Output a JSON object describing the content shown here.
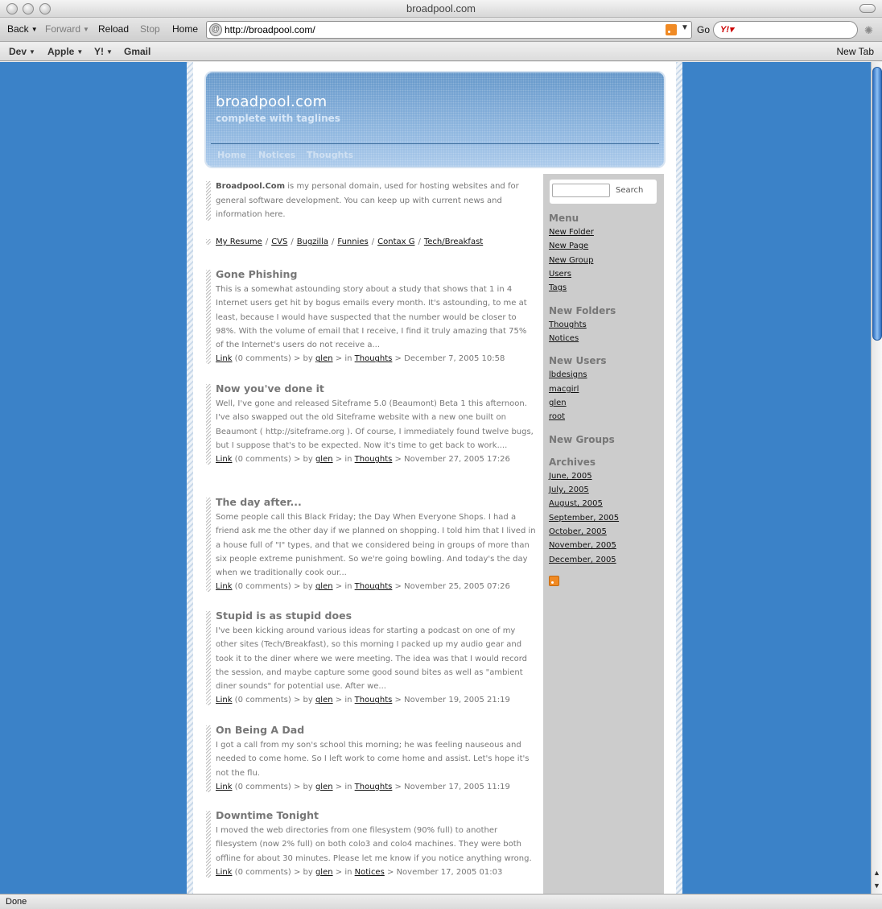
{
  "window": {
    "title": "broadpool.com"
  },
  "toolbar": {
    "back": "Back",
    "forward": "Forward",
    "reload": "Reload",
    "stop": "Stop",
    "home": "Home",
    "url": "http://broadpool.com/",
    "go": "Go"
  },
  "bookmarks": {
    "dev": "Dev",
    "apple": "Apple",
    "yahoo": "Y!",
    "gmail": "Gmail",
    "new_tab": "New Tab"
  },
  "header": {
    "title": "broadpool.com",
    "tagline": "complete with taglines",
    "nav": [
      "Home",
      "Notices",
      "Thoughts"
    ]
  },
  "intro": {
    "bold": "Broadpool.Com",
    "text": " is my personal domain, used for hosting websites and for general software development. You can keep up with current news and information here."
  },
  "links": [
    "My Resume",
    "CVS",
    "Bugzilla",
    "Funnies",
    "Contax G",
    "Tech/Breakfast"
  ],
  "meta_labels": {
    "link": "Link",
    "comments": "(0 comments)",
    "by": "> by",
    "in": "> in",
    "gt": ">"
  },
  "posts": [
    {
      "title": "Gone Phishing",
      "body": "This is a somewhat astounding story about a study that shows that 1 in 4 Internet users get hit by bogus emails every month. It's astounding, to me at least, because I would have suspected that the number would be closer to 98%. With the volume of email that I receive, I find it truly amazing that 75% of the Internet's users do not receive a...",
      "author": "glen",
      "category": "Thoughts",
      "date": "December 7, 2005 10:58"
    },
    {
      "title": "Now you've done it",
      "body": "Well, I've gone and released Siteframe 5.0 (Beaumont) Beta 1 this afternoon. I've also swapped out the old Siteframe website with a new one built on Beaumont ( http://siteframe.org ). Of course, I immediately found twelve bugs, but I suppose that's to be expected. Now it's time to get back to work....",
      "author": "glen",
      "category": "Thoughts",
      "date": "November 27, 2005 17:26"
    },
    {
      "title": "The day after...",
      "body": "Some people call this Black Friday; the Day When Everyone Shops. I had a friend ask me the other day if we planned on shopping. I told him that I lived in a house full of \"I\" types, and that we considered being in groups of more than six people extreme punishment. So we're going bowling. And today's the day when we traditionally cook our...",
      "author": "glen",
      "category": "Thoughts",
      "date": "November 25, 2005 07:26"
    },
    {
      "title": "Stupid is as stupid does",
      "body": "I've been kicking around various ideas for starting a podcast on one of my other sites (Tech/Breakfast), so this morning I packed up my audio gear and took it to the diner where we were meeting. The idea was that I would record the session, and maybe capture some good sound bites as well as \"ambient diner sounds\" for potential use. After we...",
      "author": "glen",
      "category": "Thoughts",
      "date": "November 19, 2005 21:19"
    },
    {
      "title": "On Being A Dad",
      "body": "I got a call from my son's school this morning; he was feeling nauseous and needed to come home. So I left work to come home and assist. Let's hope it's not the flu.",
      "author": "glen",
      "category": "Thoughts",
      "date": "November 17, 2005 11:19"
    },
    {
      "title": "Downtime Tonight",
      "body": "I moved the web directories from one filesystem (90% full) to another filesystem (now 2% full) on both colo3 and colo4 machines. They were both offline for about 30 minutes. Please let me know if you notice anything wrong.",
      "author": "glen",
      "category": "Notices",
      "date": "November 17, 2005 01:03"
    }
  ],
  "sidebar": {
    "search_button": "Search",
    "menu_title": "Menu",
    "menu": [
      "New Folder",
      "New Page",
      "New Group",
      "Users",
      "Tags"
    ],
    "folders_title": "New Folders",
    "folders": [
      "Thoughts",
      "Notices"
    ],
    "users_title": "New Users",
    "users": [
      "lbdesigns",
      "macgirl",
      "glen",
      "root"
    ],
    "groups_title": "New Groups",
    "archives_title": "Archives",
    "archives": [
      "June, 2005",
      "July, 2005",
      "August, 2005",
      "September, 2005",
      "October, 2005",
      "November, 2005",
      "December, 2005"
    ]
  },
  "status": {
    "text": "Done"
  },
  "colors": {
    "page_bg": "#3b82c8",
    "sidebar_bg": "#cccccc",
    "header_blue": "#5d92c7"
  }
}
